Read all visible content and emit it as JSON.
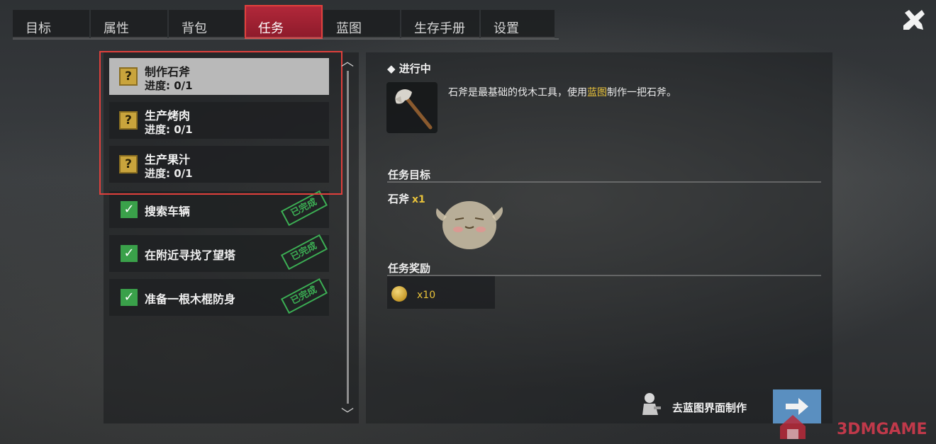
{
  "tabs": [
    "目标",
    "属性",
    "背包",
    "任务",
    "蓝图",
    "生存手册",
    "设置"
  ],
  "active_tab": "任务",
  "quests_in_progress": [
    {
      "name": "制作石斧",
      "progress": "进度: 0/1",
      "selected": true
    },
    {
      "name": "生产烤肉",
      "progress": "进度: 0/1",
      "selected": false
    },
    {
      "name": "生产果汁",
      "progress": "进度: 0/1",
      "selected": false
    }
  ],
  "quests_completed": [
    {
      "name": "搜索车辆",
      "stamp": "已完成"
    },
    {
      "name": "在附近寻找了望塔",
      "stamp": "已完成"
    },
    {
      "name": "准备一根木棍防身",
      "stamp": "已完成"
    }
  ],
  "detail": {
    "status": "◆ 进行中",
    "description_prefix": "石斧是最基础的伐木工具，使用",
    "description_highlight": "蓝图",
    "description_suffix": "制作一把石斧。",
    "goal_title": "任务目标",
    "goal_item": "石斧",
    "goal_count": "x1",
    "reward_title": "任务奖励",
    "reward_count": "x10",
    "craft_label": "去蓝图界面制作"
  },
  "watermark": "3DMGAME",
  "colors": {
    "accent_red": "#b2283a",
    "highlight_yellow": "#e8c23a",
    "done_green": "#3aa14a",
    "button_blue": "#5a8fc0"
  },
  "icons": [
    "close-icon",
    "question-icon",
    "check-icon",
    "stone-axe-icon",
    "coin-icon",
    "arrow-right-icon",
    "scroll-up-icon",
    "scroll-down-icon"
  ]
}
